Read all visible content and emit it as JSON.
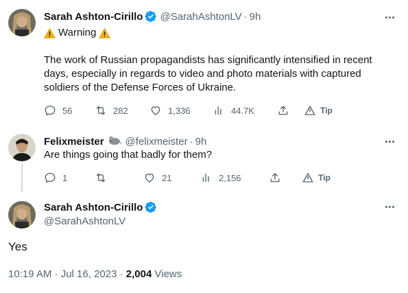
{
  "tweet1": {
    "name": "Sarah Ashton-Cirillo",
    "handle": "@SarahAshtonLV",
    "separator": "·",
    "time": "9h",
    "warning_label": "Warning",
    "text": "The work of Russian propagandists has significantly intensified in recent days, especially in regards to video and photo materials with captured soldiers of the Defense Forces of Ukraine.",
    "replies": "56",
    "retweets": "282",
    "likes": "1,336",
    "views": "44.7K",
    "tip_label": "Tip"
  },
  "tweet2": {
    "name": "Felixmeister",
    "handle": "@felixmeister",
    "separator": "·",
    "time": "9h",
    "text": "Are things going that badly for them?",
    "replies": "1",
    "retweets": "",
    "likes": "21",
    "views": "2,156",
    "tip_label": "Tip"
  },
  "tweet3": {
    "name": "Sarah Ashton-Cirillo",
    "handle": "@SarahAshtonLV",
    "text": "Yes",
    "timestamp": "10:19 AM · Jul 16, 2023",
    "separator": "·",
    "views_count": "2,004",
    "views_label": "Views"
  },
  "colors": {
    "verified": "#1d9bf0",
    "secondary_text": "#536471",
    "warning": "#f4b400",
    "thread_line": "#cfd9de"
  },
  "icons": [
    "verified-badge-icon",
    "warning-icon",
    "reply-icon",
    "retweet-icon",
    "like-icon",
    "views-icon",
    "share-icon",
    "tip-icon",
    "mouse-icon",
    "more-icon"
  ]
}
